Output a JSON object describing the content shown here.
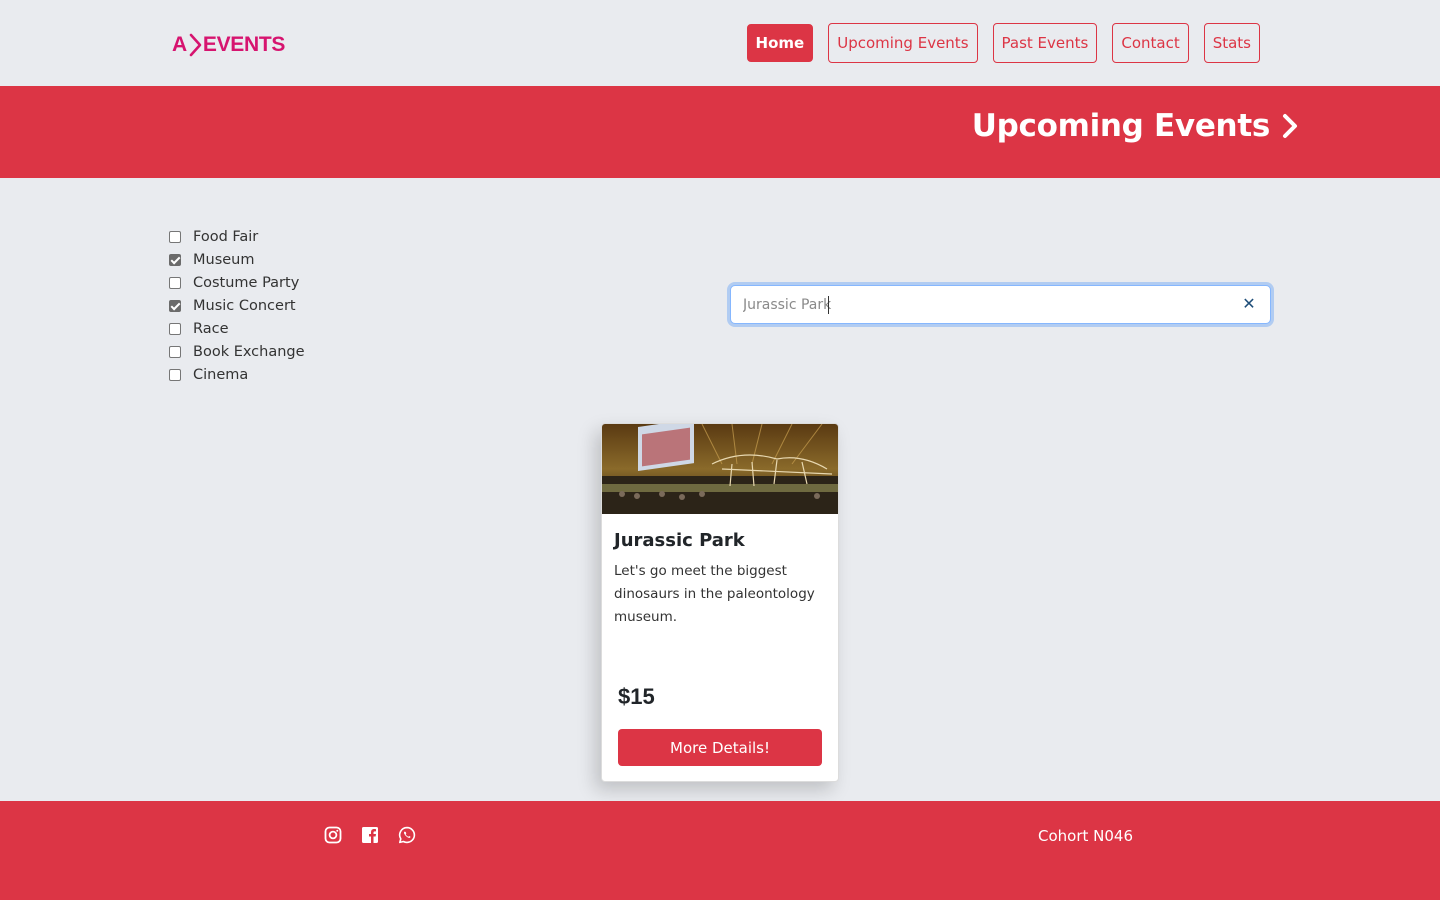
{
  "brand": {
    "logo_text_left": "A",
    "logo_text_right": "EVENTS",
    "color": "#d6146f"
  },
  "nav": {
    "items": [
      {
        "label": "Home",
        "active": true
      },
      {
        "label": "Upcoming Events",
        "active": false
      },
      {
        "label": "Past Events",
        "active": false
      },
      {
        "label": "Contact",
        "active": false
      },
      {
        "label": "Stats",
        "active": false
      }
    ]
  },
  "banner": {
    "title": "Upcoming Events",
    "icon": "chevron-right-icon"
  },
  "filters": [
    {
      "label": "Food Fair",
      "checked": false
    },
    {
      "label": "Museum",
      "checked": true
    },
    {
      "label": "Costume Party",
      "checked": false
    },
    {
      "label": "Music Concert",
      "checked": true
    },
    {
      "label": "Race",
      "checked": false
    },
    {
      "label": "Book Exchange",
      "checked": false
    },
    {
      "label": "Cinema",
      "checked": false
    }
  ],
  "search": {
    "value": "Jurassic Park",
    "clear_icon": "close-icon"
  },
  "events": [
    {
      "title": "Jurassic Park",
      "description": "Let's go meet the biggest dinosaurs in the paleontology museum.",
      "price": "$15",
      "button": "More Details!"
    }
  ],
  "footer": {
    "social": [
      "instagram-icon",
      "facebook-icon",
      "whatsapp-icon"
    ],
    "cohort": "Cohort N046"
  },
  "colors": {
    "accent": "#dc3545",
    "background": "#e9ebef"
  }
}
